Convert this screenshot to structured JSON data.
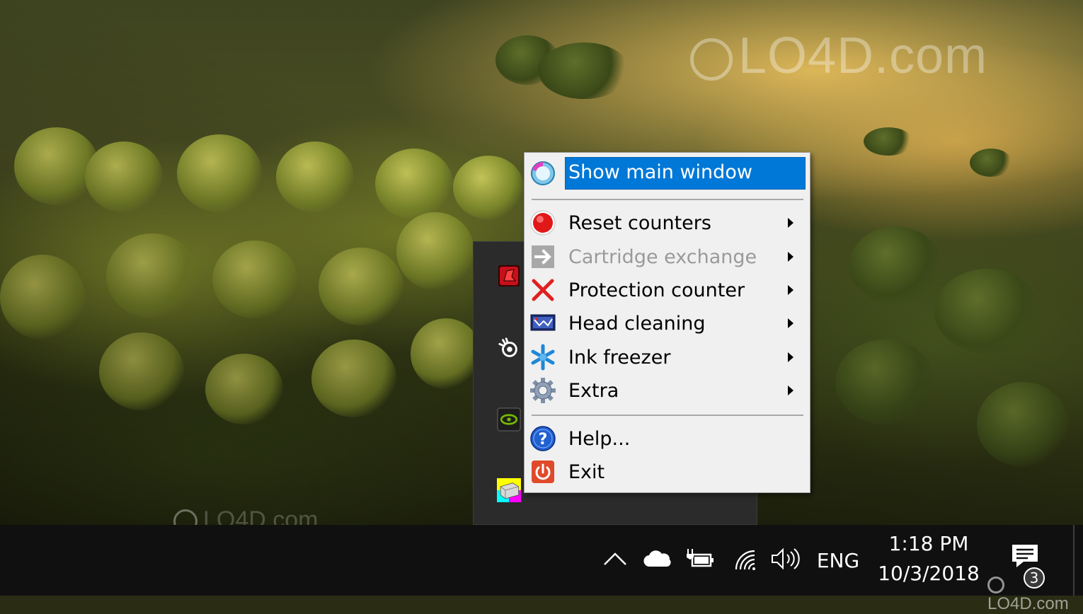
{
  "context_menu": {
    "items": [
      {
        "label": "Show main window",
        "icon": "app-window-icon",
        "selected": true,
        "submenu": false
      },
      {
        "label": "Reset counters",
        "icon": "red-dot-icon",
        "submenu": true
      },
      {
        "label": "Cartridge exchange",
        "icon": "arrow-right-icon",
        "disabled": true,
        "submenu": true
      },
      {
        "label": "Protection counter",
        "icon": "red-x-icon",
        "submenu": true
      },
      {
        "label": "Head cleaning",
        "icon": "printer-head-icon",
        "submenu": true
      },
      {
        "label": "Ink freezer",
        "icon": "snowflake-icon",
        "submenu": true
      },
      {
        "label": "Extra",
        "icon": "gear-icon",
        "submenu": true
      },
      {
        "label": "Help...",
        "icon": "help-icon",
        "submenu": false
      },
      {
        "label": "Exit",
        "icon": "exit-icon",
        "submenu": false
      }
    ],
    "highlight_color": "#0078d7"
  },
  "tray_overflow": {
    "apps": [
      "red-app-icon",
      "steelseries-icon",
      "nvidia-icon",
      "printer-app-icon"
    ]
  },
  "taskbar": {
    "language": "ENG",
    "clock_time": "1:18 PM",
    "clock_date": "10/3/2018",
    "notification_count": "3",
    "icons": [
      "chevron-up-icon",
      "onedrive-icon",
      "power-icon",
      "wifi-icon",
      "volume-icon",
      "action-center-icon"
    ]
  },
  "watermarks": {
    "top": "LO4D.com",
    "bottom": "LO4D.com",
    "corner": "LO4D.com"
  }
}
